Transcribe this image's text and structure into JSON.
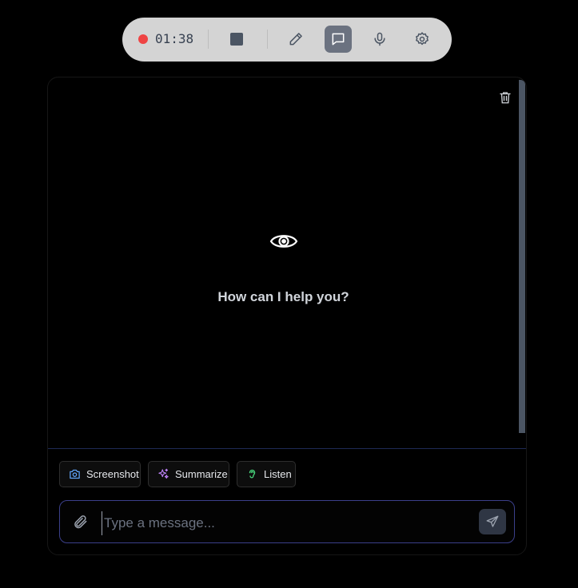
{
  "toolbar": {
    "timer": "01:38",
    "icons": [
      "recording-dot",
      "stop-icon",
      "pen-icon",
      "chat-icon",
      "microphone-icon",
      "gear-icon"
    ],
    "active": "chat-icon"
  },
  "chat": {
    "greeting": "How can I help you?",
    "icons": [
      "trash-icon",
      "eye-icon"
    ]
  },
  "quick_actions": [
    {
      "label": "Screenshot",
      "icon": "camera-icon"
    },
    {
      "label": "Summarize",
      "icon": "sparkles-icon"
    },
    {
      "label": "Listen",
      "icon": "ear-icon"
    }
  ],
  "composer": {
    "placeholder": "Type a message...",
    "value": "",
    "icons": [
      "paperclip-icon",
      "send-icon"
    ]
  },
  "colors": {
    "record": "#ef4444",
    "toolbar_bg": "#d4d4d4",
    "active_btn": "#6b7280",
    "input_border": "#3b3f8a",
    "camera": "#60a5fa",
    "sparkles": "#c084fc",
    "ear": "#4ade80"
  }
}
